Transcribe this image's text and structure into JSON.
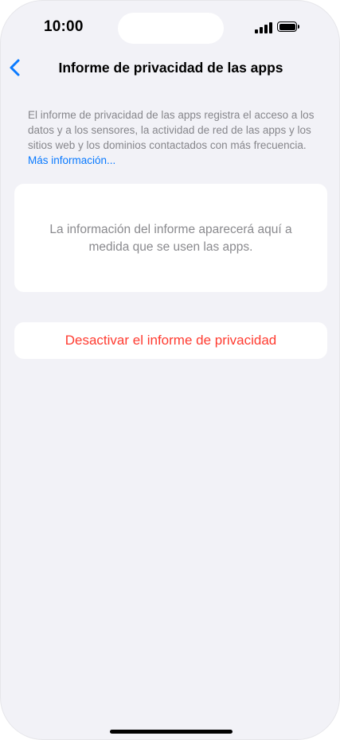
{
  "status_bar": {
    "time": "10:00",
    "icons": [
      "cellular-signal-icon",
      "battery-icon"
    ]
  },
  "nav": {
    "back_icon": "chevron-left-icon",
    "title": "Informe de privacidad de las apps"
  },
  "description": {
    "text": "El informe de privacidad de las apps registra el acceso a los datos y a los sensores, la actividad de red de las apps y los sitios web y los dominios contactados con más frecuencia.",
    "link_label": "Más información..."
  },
  "info_card": {
    "text": "La información del informe aparecerá aquí a medida que se usen las apps."
  },
  "actions": {
    "deactivate_label": "Desactivar el informe de privacidad"
  },
  "colors": {
    "background": "#f2f2f7",
    "accent": "#0a7aff",
    "destructive": "#ff3b30",
    "secondary_text": "#86868b"
  }
}
